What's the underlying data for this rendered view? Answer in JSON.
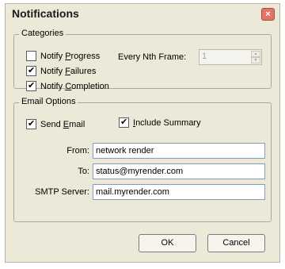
{
  "window": {
    "title": "Notifications",
    "close_label": "×"
  },
  "categories": {
    "legend": "Categories",
    "notify_progress": {
      "label_pre": "Notify ",
      "label_accel": "P",
      "label_post": "rogress",
      "checked": false
    },
    "notify_failures": {
      "label_pre": "Notify ",
      "label_accel": "F",
      "label_post": "ailures",
      "checked": true
    },
    "notify_completion": {
      "label_pre": "Notify ",
      "label_accel": "C",
      "label_post": "ompletion",
      "checked": true
    },
    "every_nth": {
      "label": "Every Nth Frame:",
      "value": "1"
    }
  },
  "email": {
    "legend": "Email Options",
    "send_email": {
      "label_pre": "Send ",
      "label_accel": "E",
      "label_post": "mail",
      "checked": true
    },
    "include_summary": {
      "label_pre": "",
      "label_accel": "I",
      "label_post": "nclude Summary",
      "checked": true
    },
    "from": {
      "label": "From:",
      "value": "network render"
    },
    "to": {
      "label": "To:",
      "value": "status@myrender.com"
    },
    "smtp": {
      "label": "SMTP Server:",
      "value": "mail.myrender.com"
    }
  },
  "buttons": {
    "ok": "OK",
    "cancel": "Cancel"
  }
}
